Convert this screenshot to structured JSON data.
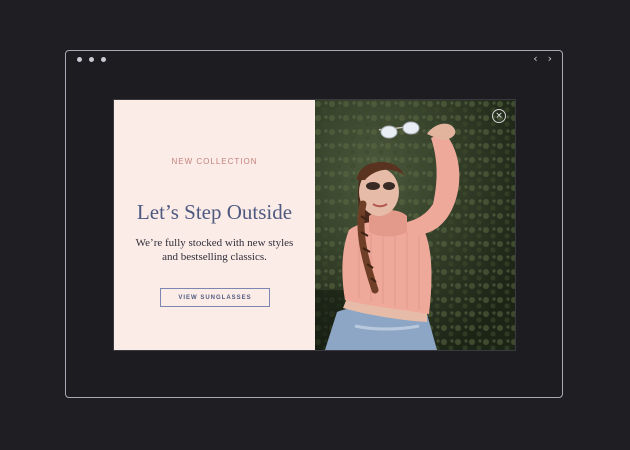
{
  "window": {
    "nav_back": "‹",
    "nav_forward": "›"
  },
  "popup": {
    "eyebrow": "NEW COLLECTION",
    "headline": "Let’s Step Outside",
    "body_line_1": "We’re fully stocked with new styles",
    "body_line_2": "and bestselling classics.",
    "cta_label": "VIEW SUNGLASSES",
    "close_glyph": "×"
  },
  "icons": {
    "close": "close-icon",
    "back": "chevron-left-icon",
    "forward": "chevron-right-icon"
  },
  "colors": {
    "page_bg": "#1f1e23",
    "panel_bg": "#fcece7",
    "headline": "#4e5a82",
    "eyebrow": "#c4827d",
    "sweater": "#efa99a",
    "jeans": "#8ea6c5"
  }
}
